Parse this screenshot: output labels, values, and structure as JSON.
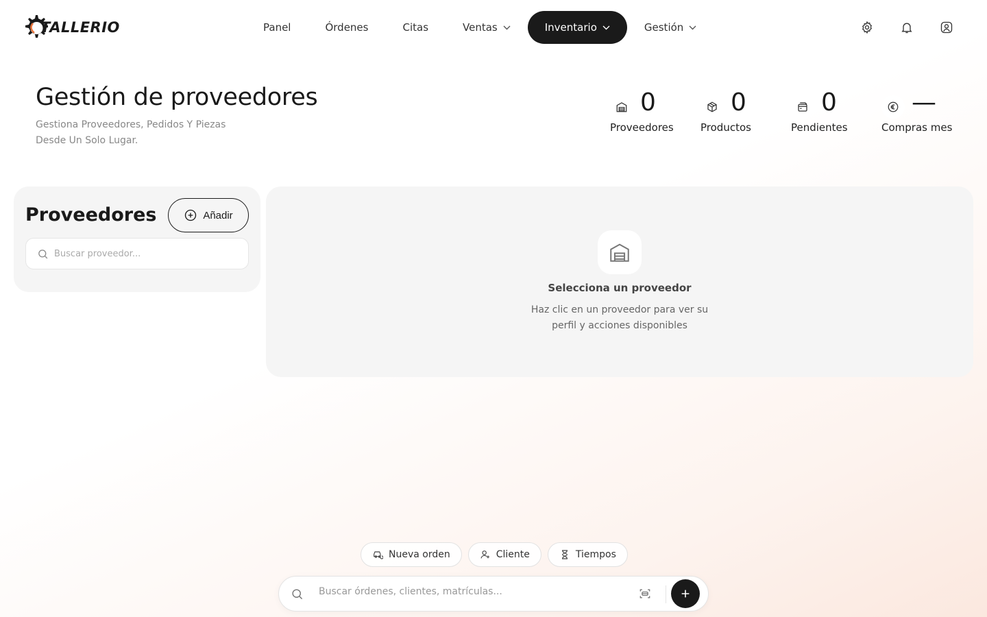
{
  "brand": {
    "name": "TALLERIO",
    "accent": "#e8733a"
  },
  "nav": {
    "items": [
      {
        "label": "Panel",
        "dropdown": false,
        "active": false
      },
      {
        "label": "Órdenes",
        "dropdown": false,
        "active": false
      },
      {
        "label": "Citas",
        "dropdown": false,
        "active": false
      },
      {
        "label": "Ventas",
        "dropdown": true,
        "active": false
      },
      {
        "label": "Inventario",
        "dropdown": true,
        "active": true
      },
      {
        "label": "Gestión",
        "dropdown": true,
        "active": false
      }
    ]
  },
  "topbar": {
    "icons": [
      "gear-icon",
      "bell-icon",
      "user-icon"
    ]
  },
  "header": {
    "title": "Gestión de proveedores",
    "subtitle": "Gestiona Proveedores, Pedidos Y Piezas Desde Un Solo Lugar."
  },
  "stats": [
    {
      "icon": "warehouse-icon",
      "value": "0",
      "label": "Proveedores"
    },
    {
      "icon": "box-icon",
      "value": "0",
      "label": "Productos"
    },
    {
      "icon": "orders-icon",
      "value": "0",
      "label": "Pendientes"
    },
    {
      "icon": "euro-icon",
      "value": "—",
      "label": "Compras mes"
    }
  ],
  "sidebar": {
    "title": "Proveedores",
    "add_label": "Añadir",
    "search_placeholder": "Buscar proveedor..."
  },
  "detail": {
    "empty_title": "Selecciona un proveedor",
    "empty_text": "Haz clic en un proveedor para ver su perfil y acciones disponibles"
  },
  "quick_actions": [
    {
      "icon": "car-icon",
      "label": "Nueva orden"
    },
    {
      "icon": "user-plus-icon",
      "label": "Cliente"
    },
    {
      "icon": "hourglass-icon",
      "label": "Tiempos"
    }
  ],
  "global_search": {
    "placeholder": "Buscar órdenes, clientes, matrículas..."
  }
}
